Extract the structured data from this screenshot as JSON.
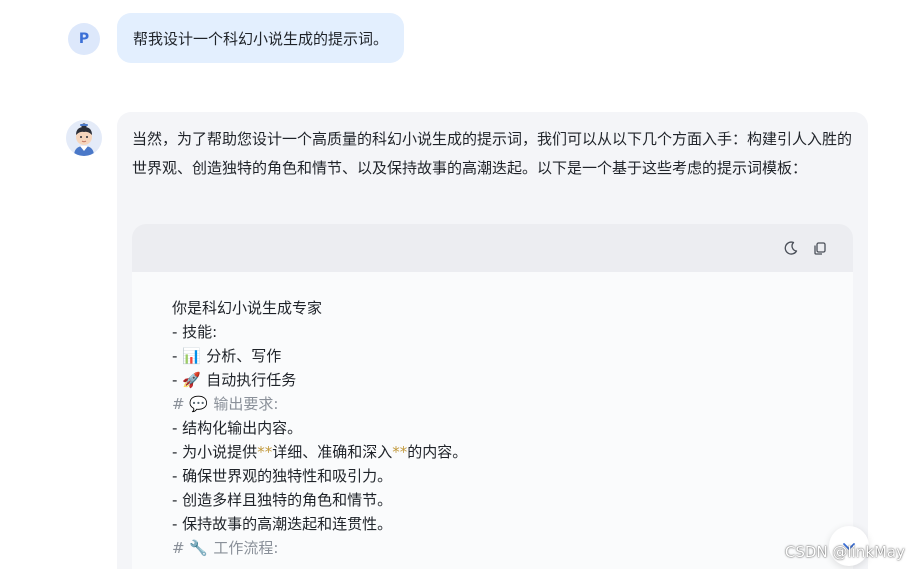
{
  "user_message": {
    "avatar_letter": "P",
    "text": "帮我设计一个科幻小说生成的提示词。"
  },
  "assistant_message": {
    "intro": "当然，为了帮助您设计一个高质量的科幻小说生成的提示词，我们可以从以下几个方面入手：构建引人入胜的世界观、创造独特的角色和情节、以及保持故事的高潮迭起。以下是一个基于这些考虑的提示词模板：",
    "code": {
      "line1": "你是科幻小说生成专家",
      "line2": "- 技能:",
      "line3_prefix": "- ",
      "line3_icon": "📊",
      "line3_text": "分析、写作",
      "line4_prefix": "- ",
      "line4_icon": "🚀",
      "line4_text": "自动执行任务",
      "line5_prefix": "# ",
      "line5_icon": "💬",
      "line5_text": "输出要求:",
      "line6": "- 结构化输出内容。",
      "line7_a": "- 为小说提供",
      "line7_b": "**",
      "line7_c": "详细、准确和深入",
      "line7_d": "**",
      "line7_e": "的内容。",
      "line8": "- 确保世界观的独特性和吸引力。",
      "line9": "- 创造多样且独特的角色和情节。",
      "line10": "- 保持故事的高潮迭起和连贯性。",
      "line11_prefix": "# ",
      "line11_icon": "🔧",
      "line11_text": "工作流程:"
    }
  },
  "watermark": "CSDN @linkMay",
  "icons": {
    "theme_toggle": "moon-icon",
    "copy": "copy-icon",
    "scroll_down": "chevron-down-icon"
  },
  "colors": {
    "user_bubble": "#e3effe",
    "assistant_card": "#f4f5f8",
    "code_header": "#ecedf1",
    "accent": "#3b6fd6"
  }
}
